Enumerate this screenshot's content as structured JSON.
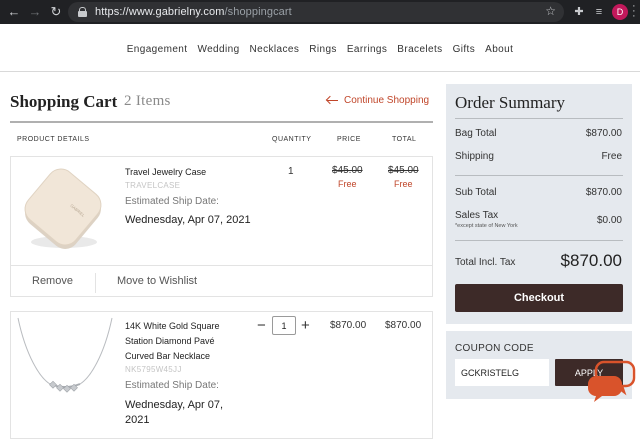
{
  "browser": {
    "url_domain": "https://www.gabrielny.com",
    "url_path": "/shoppingcart",
    "profile_initial": "D",
    "profile_color": "#c2185b"
  },
  "nav": [
    "Engagement",
    "Wedding",
    "Necklaces",
    "Rings",
    "Earrings",
    "Bracelets",
    "Gifts",
    "About"
  ],
  "cart": {
    "title": "Shopping Cart",
    "count": "2 Items",
    "continue_label": "Continue Shopping",
    "columns": {
      "details": "PRODUCT DETAILS",
      "quantity": "QUANTITY",
      "price": "PRICE",
      "total": "TOTAL"
    },
    "items": [
      {
        "name": "Travel Jewelry Case",
        "sku": "TRAVELCASE",
        "ship_label": "Estimated Ship Date:",
        "ship_date": "Wednesday, Apr 07, 2021",
        "quantity": "1",
        "price_original": "$45.00",
        "price_now": "Free",
        "total_original": "$45.00",
        "total_now": "Free",
        "remove_label": "Remove",
        "wishlist_label": "Move to Wishlist"
      },
      {
        "name": "14K White Gold Square Station Diamond Pavé Curved Bar Necklace",
        "sku": "NK5795W45JJ",
        "ship_label": "Estimated Ship Date:",
        "ship_date": "Wednesday, Apr 07, 2021",
        "quantity": "1",
        "price": "$870.00",
        "total": "$870.00"
      }
    ]
  },
  "summary": {
    "title": "Order Summary",
    "bag_total_label": "Bag Total",
    "bag_total": "$870.00",
    "shipping_label": "Shipping",
    "shipping": "Free",
    "subtotal_label": "Sub Total",
    "subtotal": "$870.00",
    "tax_label": "Sales Tax",
    "tax_note": "*except state of New York",
    "tax": "$0.00",
    "total_label": "Total Incl. Tax",
    "total": "$870.00",
    "checkout_label": "Checkout"
  },
  "coupon": {
    "label": "COUPON CODE",
    "value": "GCKRISTELG",
    "apply_label": "APPLY"
  },
  "colors": {
    "accent": "#c0462a",
    "button": "#3d2a28",
    "panel": "#e5e9ee"
  }
}
